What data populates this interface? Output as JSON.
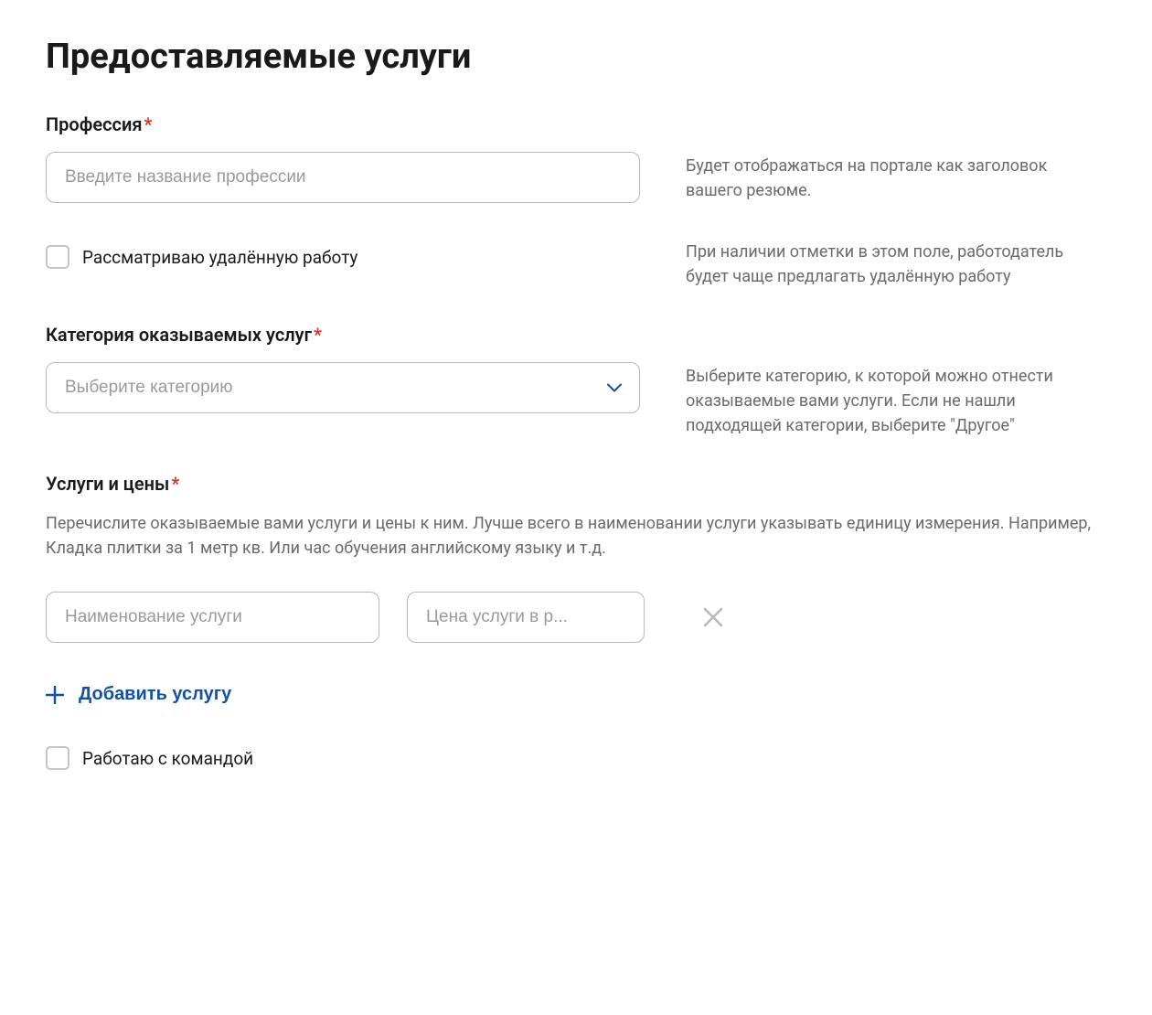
{
  "title": "Предоставляемые услуги",
  "profession": {
    "label": "Профессия",
    "placeholder": "Введите название профессии",
    "hint": "Будет отображаться на портале как заголовок вашего резюме."
  },
  "remote": {
    "label": "Рассматриваю удалённую работу",
    "hint": "При наличии отметки в этом поле, работодатель будет чаще предлагать удалённую работу"
  },
  "category": {
    "label": "Категория оказываемых услуг",
    "placeholder": "Выберите категорию",
    "hint": "Выберите категорию, к которой можно отнести оказываемые вами услуги. Если не нашли подходящей категории, выберите \"Другое\""
  },
  "services": {
    "label": "Услуги и цены",
    "description": "Перечислите оказываемые вами услуги и цены к ним. Лучше всего в наименовании услуги указывать единицу измерения. Например, Кладка плитки за 1 метр кв. Или час обучения английскому языку и т.д.",
    "name_placeholder": "Наименование услуги",
    "price_placeholder": "Цена услуги в р...",
    "add_button": "Добавить услугу"
  },
  "team": {
    "label": "Работаю с командой"
  },
  "colors": {
    "accent": "#1450a3",
    "required": "#d93025"
  }
}
